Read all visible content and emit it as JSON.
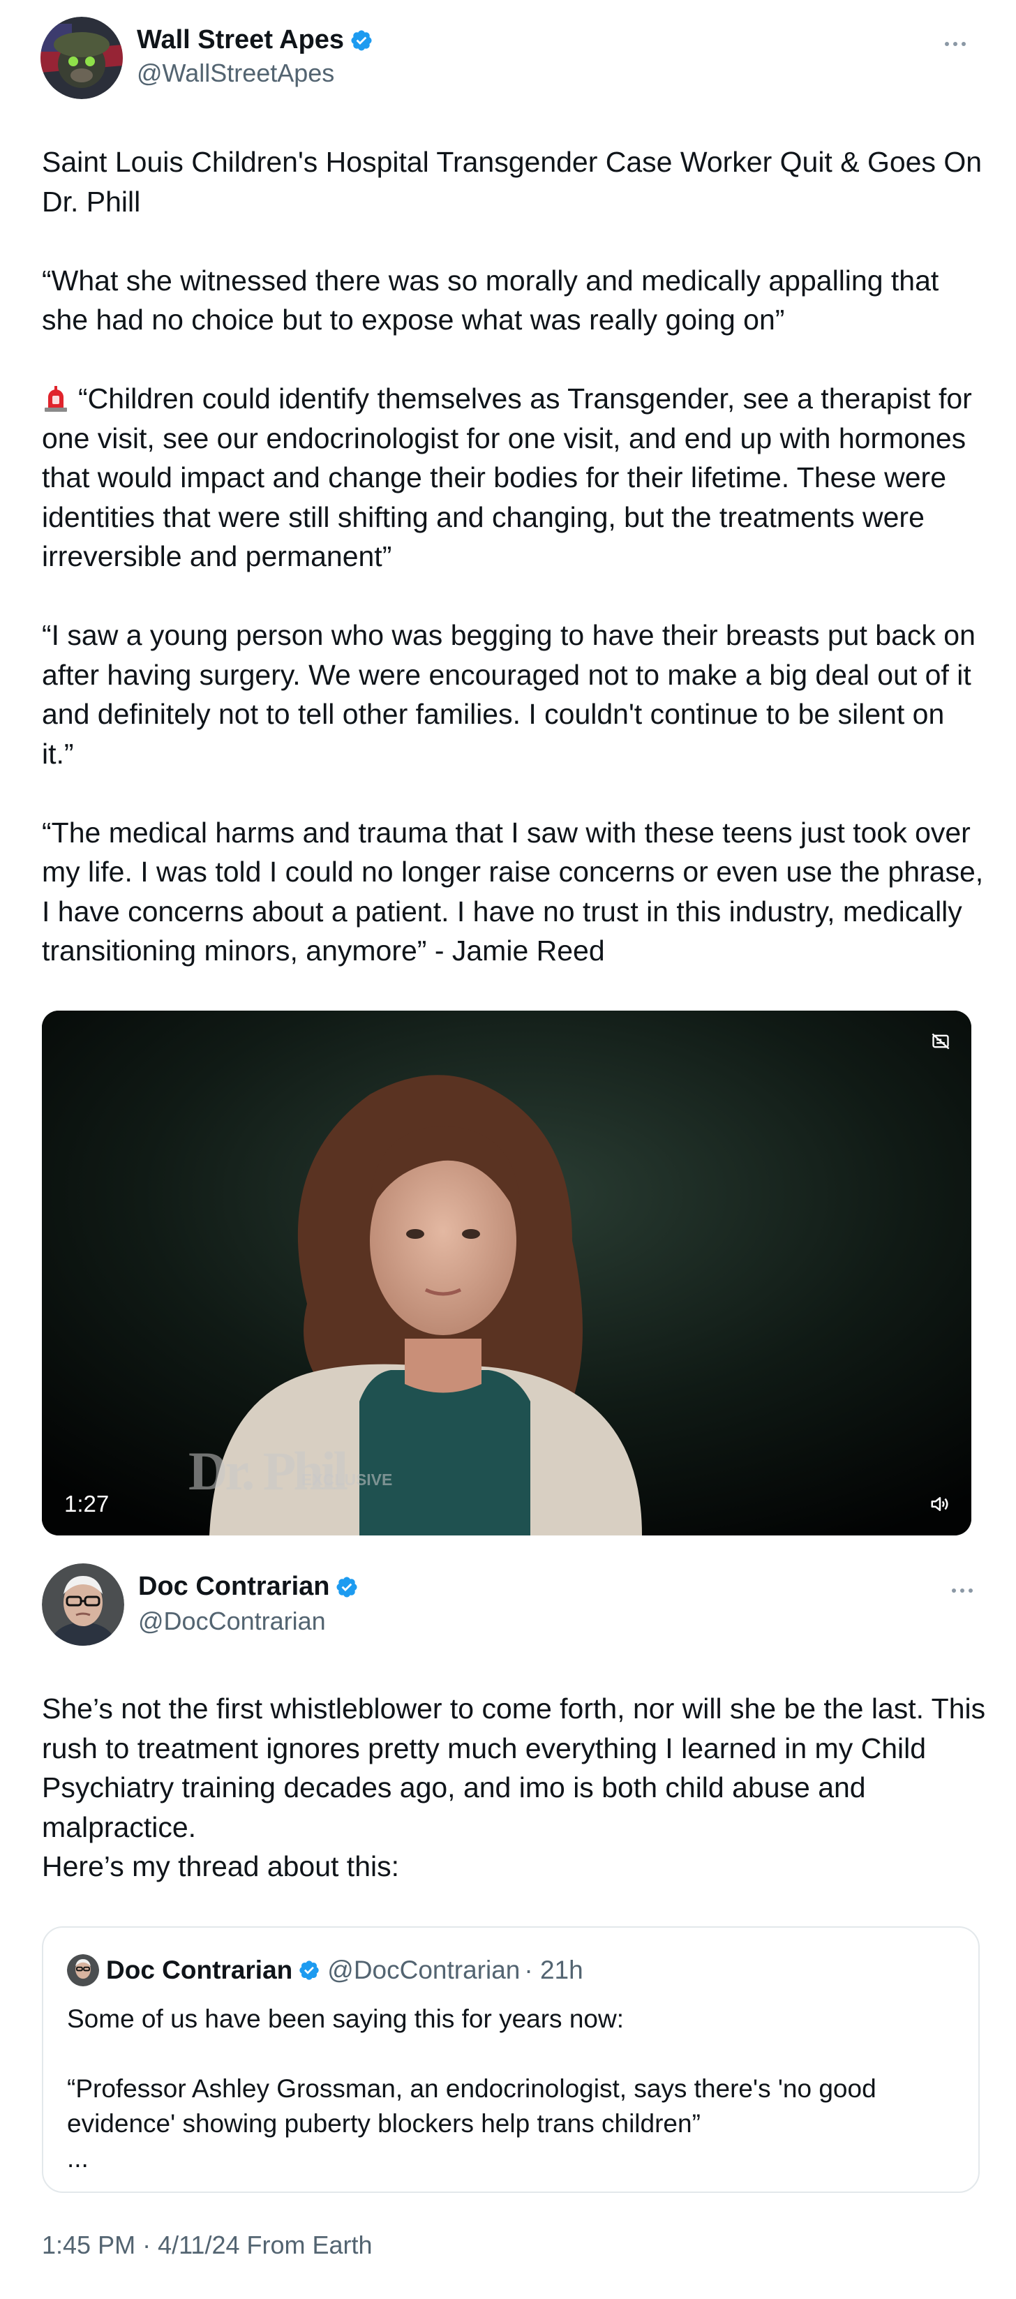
{
  "tweet1": {
    "display_name": "Wall Street Apes",
    "handle": "@WallStreetApes",
    "paragraphs": [
      "Saint Louis Children's Hospital Transgender Case Worker Quit & Goes On Dr. Phill",
      "“What she witnessed there was so morally and medically appalling that she had no choice but to expose what was really going on”",
      "“Children could identify themselves as Transgender, see a therapist for one visit, see our endocrinologist for one visit, and end up with hormones that would impact and change their bodies for their lifetime. These were identities that were still shifting and changing, but the treatments were irreversible and permanent”",
      "“I saw a young person who was begging to have their breasts put back on after having surgery. We were encouraged not to make a big deal out of it and definitely not to tell other families. I couldn't continue to be silent on it.”",
      "“The medical harms and trauma that I saw with these teens just took over my life. I was told I could no longer raise concerns or even use the phrase, I have concerns about a patient. I have no trust in this industry, medically transitioning minors, anymore” - Jamie Reed"
    ],
    "siren_icon": "police-light-emoji",
    "video": {
      "duration": "1:27",
      "watermark": "Dr. Phil",
      "watermark_sub": "EXCLUSIVE"
    }
  },
  "tweet2": {
    "display_name": "Doc Contrarian",
    "handle": "@DocContrarian",
    "text_line1": "She’s not the first whistleblower to come forth, nor will she be the last. This rush to treatment ignores pretty much everything I learned in my Child Psychiatry training decades ago, and imo is both child abuse and malpractice.",
    "text_line2": "Here’s my thread about this:",
    "quote": {
      "display_name": "Doc Contrarian",
      "handle": "@DocContrarian",
      "time": "· 21h",
      "line1": "Some of us have been saying this for years now:",
      "line2": "“Professor Ashley Grossman, an endocrinologist, says there's 'no good evidence' showing puberty blockers help trans children”",
      "ellipsis": "..."
    },
    "timestamp": "1:45 PM · 4/11/24 From Earth"
  },
  "colors": {
    "verified_blue": "#1d9bf0",
    "secondary_text": "#536471"
  }
}
